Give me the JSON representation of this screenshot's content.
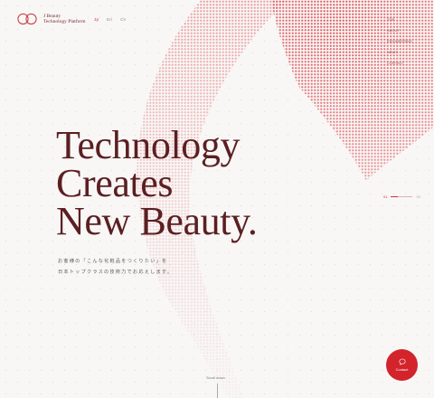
{
  "brand": {
    "name_line1": "J Beauty",
    "name_line2": "Technology Platform",
    "logo_icon": "infinity-ring-logo",
    "color": "#c8343a"
  },
  "languages": {
    "items": [
      "Jp",
      "En",
      "Cn"
    ],
    "active": "Jp"
  },
  "nav": {
    "items": [
      "TOP",
      "ABOUT",
      "ENGINEERING",
      "NEWS",
      "CONTACT"
    ]
  },
  "hero": {
    "line1": "Technology",
    "line2": "Creates",
    "line3": "New Beauty.",
    "subtitle_line1": "お客様の「こんな化粧品をつくりたい」を",
    "subtitle_line2": "日本トップクラスの技術力でお応えします。"
  },
  "slider": {
    "current": "01",
    "total": "03",
    "progress": 0.33
  },
  "scroll": {
    "label": "Scroll down"
  },
  "contact": {
    "label": "Contact",
    "icon": "chat-bubble-icon"
  },
  "colors": {
    "accent": "#d3232b",
    "hero_text": "#5b1f22",
    "background": "#f8f7f6"
  }
}
